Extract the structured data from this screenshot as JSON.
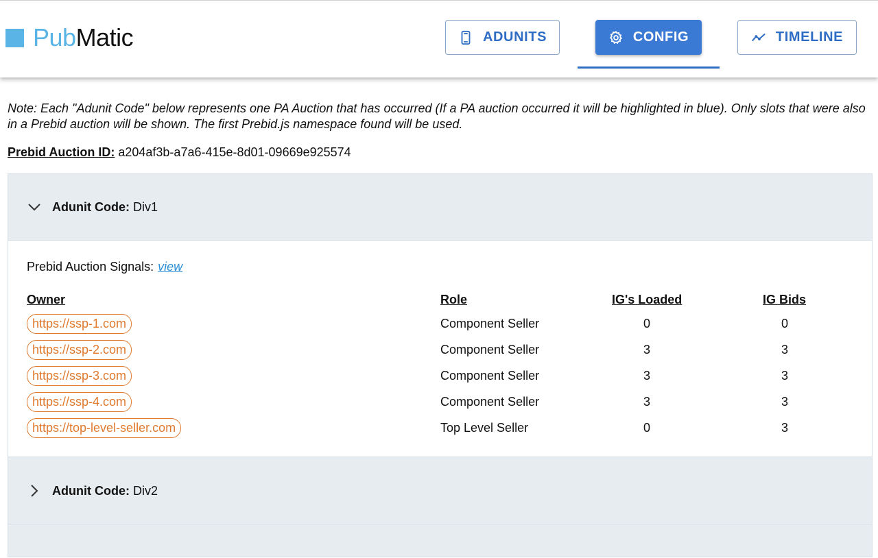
{
  "brand": {
    "part1": "Pub",
    "part2": "Matic"
  },
  "nav": {
    "adunits": "ADUNITS",
    "config": "CONFIG",
    "timeline": "TIMELINE"
  },
  "note": "Note: Each \"Adunit Code\" below represents one PA Auction that has occurred (If a PA auction occurred it will be highlighted in blue). Only slots that were also in a Prebid auction will be shown. The first Prebid.js namespace found will be used.",
  "auction": {
    "label": "Prebid Auction ID:",
    "id": "a204af3b-a7a6-415e-8d01-09669e925574"
  },
  "adunits": [
    {
      "label": "Adunit Code:",
      "code": "Div1"
    },
    {
      "label": "Adunit Code:",
      "code": "Div2"
    }
  ],
  "signals": {
    "label": "Prebid Auction Signals:",
    "link": "view"
  },
  "table": {
    "headers": {
      "owner": "Owner",
      "role": "Role",
      "loaded": "IG's Loaded",
      "bids": "IG Bids"
    },
    "rows": [
      {
        "owner": "https://ssp-1.com",
        "role": "Component Seller",
        "loaded": "0",
        "bids": "0"
      },
      {
        "owner": "https://ssp-2.com",
        "role": "Component Seller",
        "loaded": "3",
        "bids": "3"
      },
      {
        "owner": "https://ssp-3.com",
        "role": "Component Seller",
        "loaded": "3",
        "bids": "3"
      },
      {
        "owner": "https://ssp-4.com",
        "role": "Component Seller",
        "loaded": "3",
        "bids": "3"
      },
      {
        "owner": "https://top-level-seller.com",
        "role": "Top Level Seller",
        "loaded": "0",
        "bids": "3"
      }
    ]
  },
  "colors": {
    "accent": "#3a7ad4",
    "owner_pill": "#e07a2e",
    "logo": "#5ab4e5"
  },
  "icons": {
    "adunits": "mobile-device-icon",
    "config": "gear-icon",
    "timeline": "trend-line-icon"
  }
}
